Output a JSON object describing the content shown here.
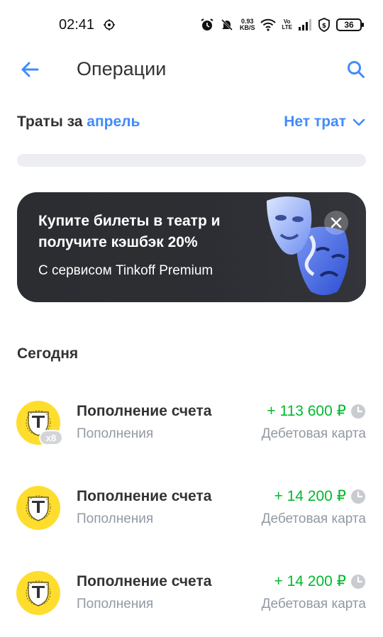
{
  "status_bar": {
    "time": "02:41",
    "speed_value": "0.93",
    "speed_unit": "KB/S",
    "volte_top": "Vo",
    "volte_bottom": "LTE",
    "battery": "36",
    "icons": [
      "alarm-icon",
      "mute-icon",
      "wifi-icon",
      "signal-icon",
      "vpn-shield-icon"
    ]
  },
  "header": {
    "title": "Операции",
    "back_icon": "arrow-left-icon",
    "search_icon": "search-icon"
  },
  "spending": {
    "label": "Траты за ",
    "month": "апрель",
    "right_label": "Нет трат",
    "dropdown_icon": "chevron-down-icon",
    "progress": 0
  },
  "promo": {
    "title": "Купите билеты в театр и получите кэшбэк 20%",
    "subtitle": "С сервисом Tinkoff Premium",
    "close_icon": "close-icon",
    "art": "theater-masks-illustration"
  },
  "section_today": "Сегодня",
  "operations": [
    {
      "title": "Пополнение счета",
      "category": "Пополнения",
      "amount": "+ 113 600 ₽",
      "account": "Дебетовая карта",
      "badge": "x8"
    },
    {
      "title": "Пополнение счета",
      "category": "Пополнения",
      "amount": "+ 14 200 ₽",
      "account": "Дебетовая карта"
    },
    {
      "title": "Пополнение счета",
      "category": "Пополнения",
      "amount": "+ 14 200 ₽",
      "account": "Дебетовая карта"
    }
  ],
  "colors": {
    "accent": "#428bf9",
    "income": "#00b92d",
    "logo_yellow": "#ffdd2d",
    "banner_bg": "#2c2e33",
    "secondary_text": "#9299a2"
  }
}
